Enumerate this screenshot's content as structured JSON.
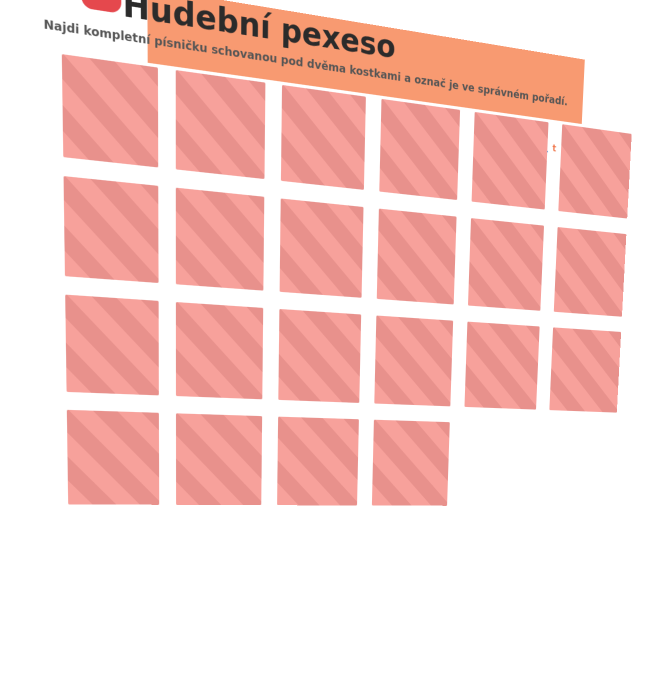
{
  "header": {
    "title": "Hudební pexeso",
    "subtitle": "Najdi kompletní písničku schovanou pod dvěma kostkami a označ je ve správném pořadí.",
    "user_label": "👤 t"
  },
  "board": {
    "cards": [
      {
        "id": 1
      },
      {
        "id": 2
      },
      {
        "id": 3
      },
      {
        "id": 4
      },
      {
        "id": 5
      },
      {
        "id": 6
      },
      {
        "id": 7
      },
      {
        "id": 8
      },
      {
        "id": 9
      },
      {
        "id": 10
      },
      {
        "id": 11
      },
      {
        "id": 12
      },
      {
        "id": 13
      },
      {
        "id": 14
      },
      {
        "id": 15
      },
      {
        "id": 16
      },
      {
        "id": 17
      },
      {
        "id": 18
      },
      {
        "id": 19
      },
      {
        "id": 20
      },
      {
        "id": 21
      },
      {
        "id": 22
      }
    ]
  },
  "colors": {
    "banner": "#f89a71",
    "logo": "#e5484d",
    "card_light": "#f7a19b",
    "card_dark": "#e8918c"
  },
  "icons": {
    "logo": "app-logo-icon",
    "user": "user-icon"
  }
}
